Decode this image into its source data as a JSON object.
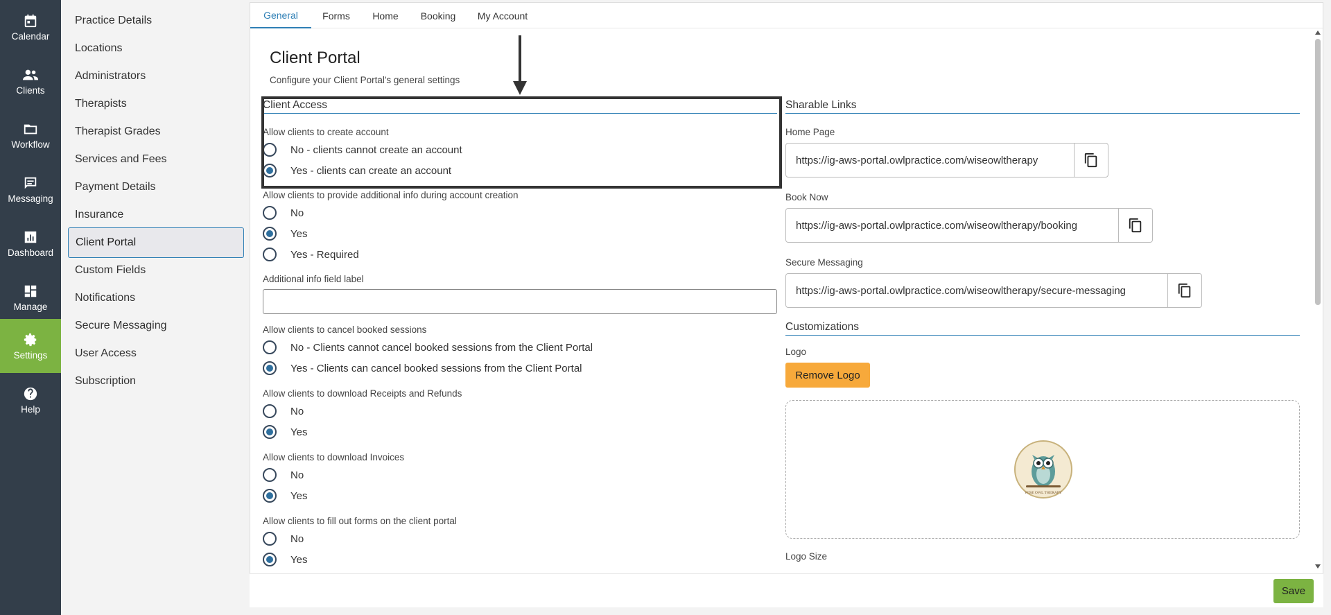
{
  "rail": [
    {
      "label": "Calendar",
      "icon": "calendar-icon"
    },
    {
      "label": "Clients",
      "icon": "clients-icon"
    },
    {
      "label": "Workflow",
      "icon": "folder-icon"
    },
    {
      "label": "Messaging",
      "icon": "message-icon"
    },
    {
      "label": "Dashboard",
      "icon": "chart-icon"
    },
    {
      "label": "Manage",
      "icon": "grid-icon"
    },
    {
      "label": "Settings",
      "icon": "gear-icon",
      "active": true
    },
    {
      "label": "Help",
      "icon": "help-icon"
    }
  ],
  "settings_nav": [
    "Practice Details",
    "Locations",
    "Administrators",
    "Therapists",
    "Therapist Grades",
    "Services and Fees",
    "Payment Details",
    "Insurance",
    "Client Portal",
    "Custom Fields",
    "Notifications",
    "Secure Messaging",
    "User Access",
    "Subscription"
  ],
  "settings_nav_active": "Client Portal",
  "tabs": [
    "General",
    "Forms",
    "Home",
    "Booking",
    "My Account"
  ],
  "tab_active": "General",
  "page": {
    "title": "Client Portal",
    "description": "Configure your Client Portal's general settings"
  },
  "client_access": {
    "heading": "Client Access",
    "create_account": {
      "label": "Allow clients to create account",
      "options": [
        "No - clients cannot create an account",
        "Yes - clients can create an account"
      ],
      "selected": 1
    },
    "additional_info": {
      "label": "Allow clients to provide additional info during account creation",
      "options": [
        "No",
        "Yes",
        "Yes - Required"
      ],
      "selected": 1
    },
    "additional_info_field": {
      "label": "Additional info field label",
      "value": ""
    },
    "cancel_sessions": {
      "label": "Allow clients to cancel booked sessions",
      "options": [
        "No - Clients cannot cancel booked sessions from the Client Portal",
        "Yes - Clients can cancel booked sessions from the Client Portal"
      ],
      "selected": 1
    },
    "receipts": {
      "label": "Allow clients to download Receipts and Refunds",
      "options": [
        "No",
        "Yes"
      ],
      "selected": 1
    },
    "invoices": {
      "label": "Allow clients to download Invoices",
      "options": [
        "No",
        "Yes"
      ],
      "selected": 1
    },
    "forms": {
      "label": "Allow clients to fill out forms on the client portal",
      "options": [
        "No",
        "Yes"
      ],
      "selected": 1
    }
  },
  "sharable_links": {
    "heading": "Sharable Links",
    "home_page": {
      "label": "Home Page",
      "url": "https://ig-aws-portal.owlpractice.com/wiseowltherapy"
    },
    "book_now": {
      "label": "Book Now",
      "url": "https://ig-aws-portal.owlpractice.com/wiseowltherapy/booking"
    },
    "secure_messaging": {
      "label": "Secure Messaging",
      "url": "https://ig-aws-portal.owlpractice.com/wiseowltherapy/secure-messaging"
    }
  },
  "customizations": {
    "heading": "Customizations",
    "logo_label": "Logo",
    "remove_logo": "Remove Logo",
    "logo_text": "WISE OWL THERAPY",
    "logo_size_label": "Logo Size"
  },
  "save_label": "Save",
  "colors": {
    "rail_bg": "#333e4a",
    "accent_green": "#7cb342",
    "accent_blue": "#2e7fb5",
    "button_orange": "#f7a93b"
  }
}
